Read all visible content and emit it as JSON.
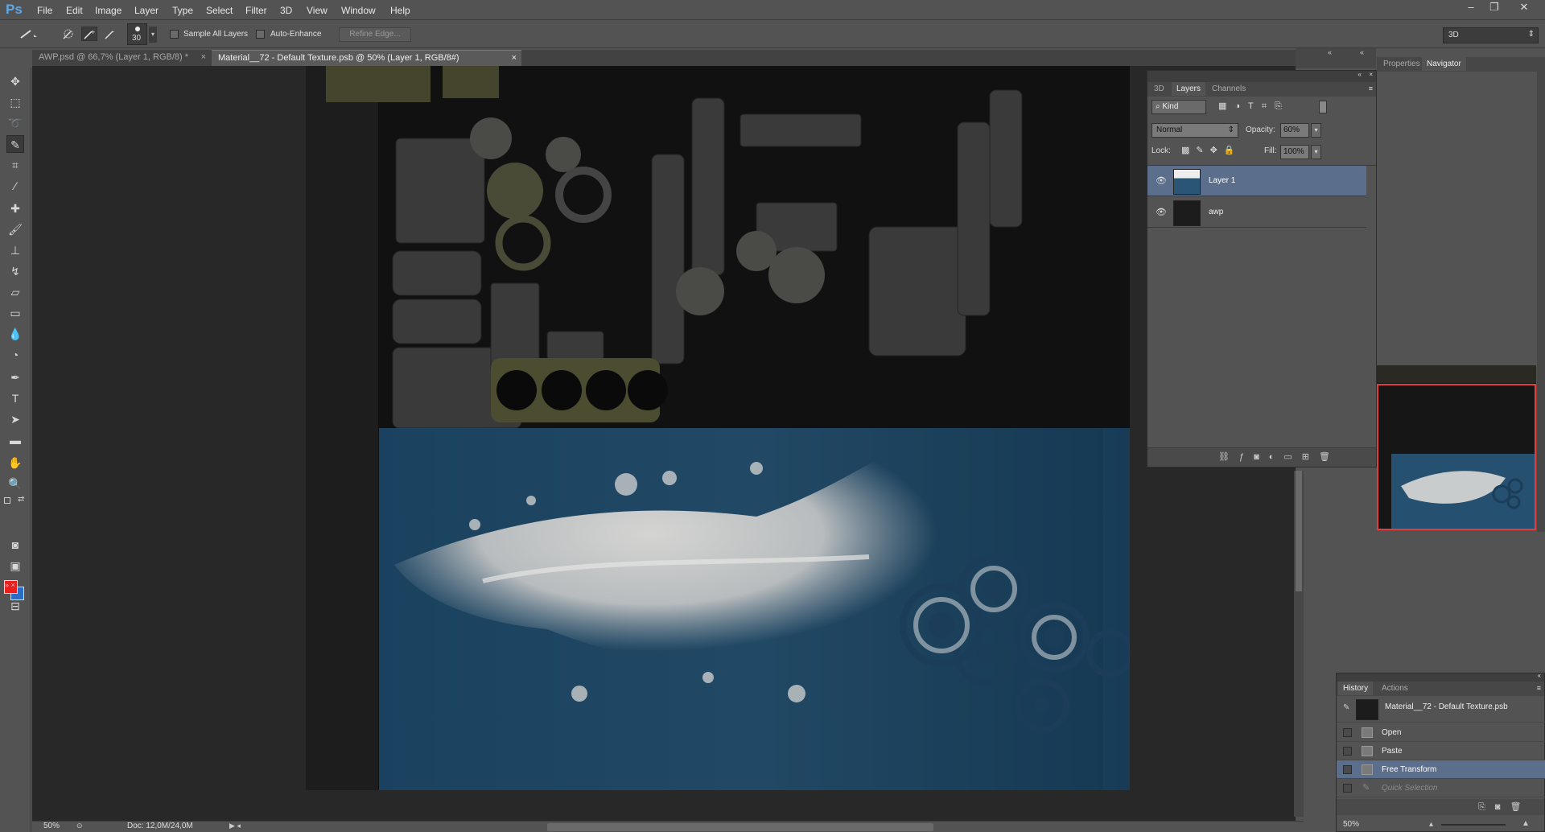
{
  "app": {
    "logo": "Ps"
  },
  "menu": [
    "File",
    "Edit",
    "Image",
    "Layer",
    "Type",
    "Select",
    "Filter",
    "3D",
    "View",
    "Window",
    "Help"
  ],
  "workspace": "3D",
  "options": {
    "brush_size": "30",
    "sample_all_layers": "Sample All Layers",
    "auto_enhance": "Auto-Enhance",
    "refine_edge": "Refine Edge..."
  },
  "tabs": [
    {
      "label": "AWP.psd @ 66,7% (Layer 1, RGB/8) *",
      "active": false
    },
    {
      "label": "Material__72 - Default Texture.psb @ 50% (Layer 1, RGB/8#)",
      "active": true
    }
  ],
  "layers_panel": {
    "tabs": [
      "3D",
      "Layers",
      "Channels"
    ],
    "kind": "Kind",
    "blend_mode": "Normal",
    "opacity_label": "Opacity:",
    "opacity": "60%",
    "lock_label": "Lock:",
    "fill_label": "Fill:",
    "fill": "100%",
    "layers": [
      {
        "name": "Layer 1",
        "selected": true
      },
      {
        "name": "awp",
        "selected": false
      }
    ]
  },
  "nav_panel": {
    "tabs": [
      "Properties",
      "Navigator"
    ],
    "zoom": "50%"
  },
  "history_panel": {
    "tabs": [
      "History",
      "Actions"
    ],
    "snapshot": "Material__72 - Default Texture.psb",
    "items": [
      {
        "label": "Open",
        "selected": false,
        "disabled": false
      },
      {
        "label": "Paste",
        "selected": false,
        "disabled": false
      },
      {
        "label": "Free Transform",
        "selected": true,
        "disabled": false
      },
      {
        "label": "Quick Selection",
        "selected": false,
        "disabled": true
      }
    ]
  },
  "status": {
    "zoom": "50%",
    "doc": "Doc: 12,0M/24,0M"
  },
  "colors": {
    "foreground": "#e8201e",
    "background": "#2b6cc4",
    "selection": "#5b6e8c"
  }
}
